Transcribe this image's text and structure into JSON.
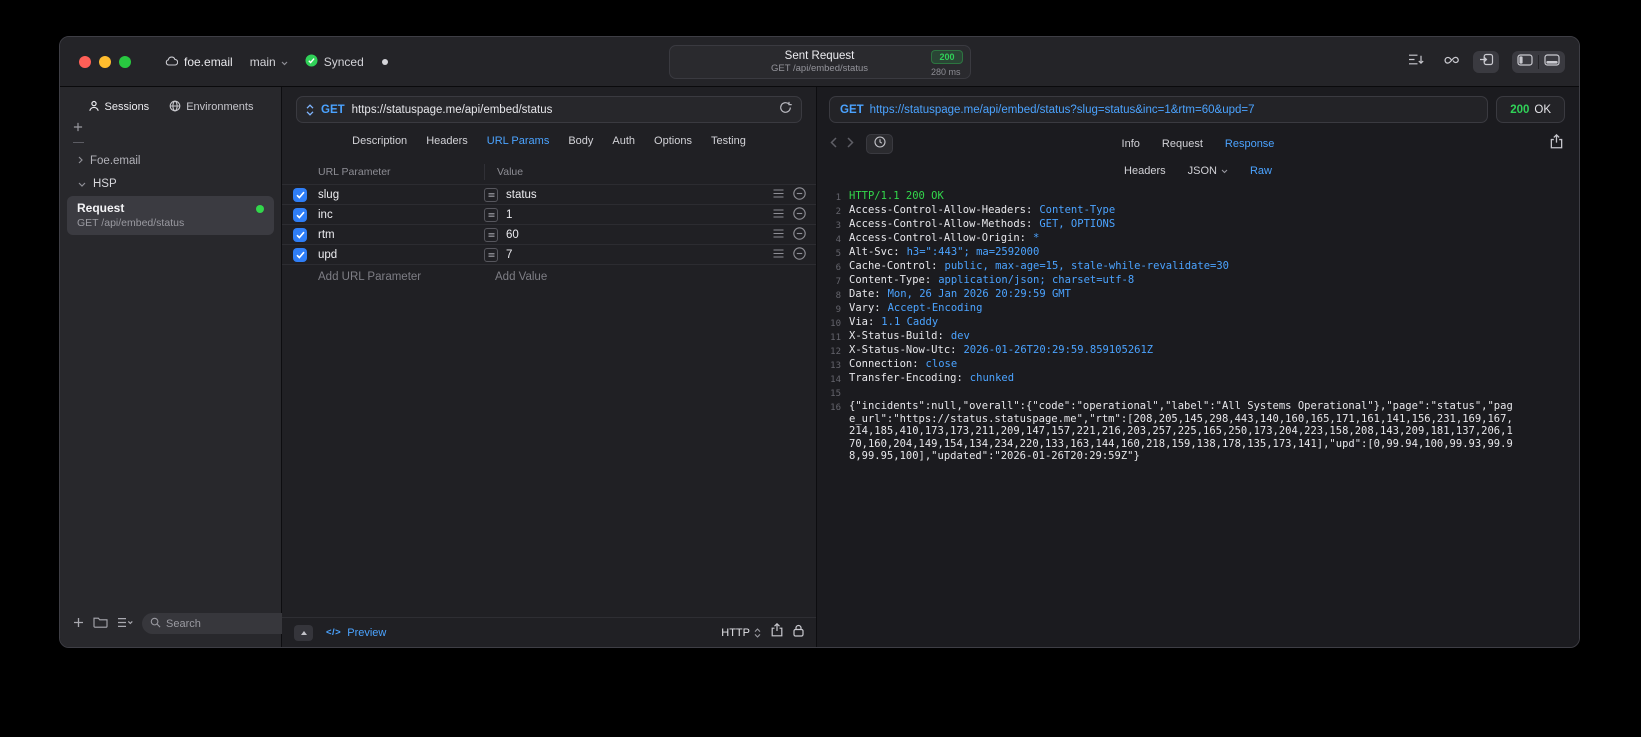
{
  "colors": {
    "accent_blue": "#4BA3FF",
    "success_green": "#30D158",
    "traffic_red": "#FF5F57",
    "traffic_yellow": "#FEBC2E",
    "traffic_green": "#28C840"
  },
  "icons": {
    "project": "cloud",
    "branch": "chevron-down",
    "synced": "check-circle",
    "sessions_tab": "person",
    "environments_tab": "globe",
    "method_selector": "up-down-arrows",
    "reload": "circular-arrow",
    "row_reorder": "hamburger-lines",
    "row_remove": "minus-circle",
    "share": "square-arrow-up",
    "lock": "padlock",
    "history": "clock",
    "search": "magnifier"
  },
  "titlebar": {
    "project": "foe.email",
    "branch": "main",
    "sync_status": "Synced",
    "request_title": "Sent Request",
    "status_badge": "200",
    "request_subtitle": "GET /api/embed/status",
    "duration": "280 ms"
  },
  "sidebar": {
    "tabs": [
      {
        "label": "Sessions"
      },
      {
        "label": "Environments"
      }
    ],
    "tree": {
      "group1": "Foe.email",
      "group2": "HSP"
    },
    "request_item": {
      "title": "Request",
      "subtitle": "GET /api/embed/status"
    },
    "search": {
      "placeholder": "Search"
    }
  },
  "request_editor": {
    "method": "GET",
    "url": "https://statuspage.me/api/embed/status",
    "tabs": [
      "Description",
      "Headers",
      "URL Params",
      "Body",
      "Auth",
      "Options",
      "Testing"
    ],
    "active_tab": "URL Params",
    "params": {
      "columns": {
        "name": "URL Parameter",
        "value": "Value"
      },
      "rows": [
        {
          "name": "slug",
          "value": "status",
          "checked": true
        },
        {
          "name": "inc",
          "value": "1",
          "checked": true
        },
        {
          "name": "rtm",
          "value": "60",
          "checked": true
        },
        {
          "name": "upd",
          "value": "7",
          "checked": true
        }
      ],
      "add_name": "Add URL Parameter",
      "add_value": "Add Value"
    },
    "footer": {
      "code_glyph": "</>",
      "preview": "Preview",
      "protocol": "HTTP"
    }
  },
  "response_viewer": {
    "method": "GET",
    "url": "https://statuspage.me/api/embed/status?slug=status&inc=1&rtm=60&upd=7",
    "status_code": "200",
    "status_text": "OK",
    "tabs": [
      "Info",
      "Request",
      "Response"
    ],
    "active_tab": "Response",
    "subtabs": [
      "Headers",
      "JSON",
      "Raw"
    ],
    "active_subtab": "Raw",
    "raw": {
      "status_line": {
        "num": "1",
        "text": "HTTP/1.1 200 OK"
      },
      "headers": [
        {
          "num": "2",
          "key": "Access-Control-Allow-Headers:",
          "value": "Content-Type"
        },
        {
          "num": "3",
          "key": "Access-Control-Allow-Methods:",
          "value": "GET, OPTIONS"
        },
        {
          "num": "4",
          "key": "Access-Control-Allow-Origin:",
          "value": "*"
        },
        {
          "num": "5",
          "key": "Alt-Svc:",
          "value": "h3=\":443\"; ma=2592000"
        },
        {
          "num": "6",
          "key": "Cache-Control:",
          "value": "public, max-age=15, stale-while-revalidate=30"
        },
        {
          "num": "7",
          "key": "Content-Type:",
          "value": "application/json; charset=utf-8"
        },
        {
          "num": "8",
          "key": "Date:",
          "value": "Mon, 26 Jan 2026 20:29:59 GMT"
        },
        {
          "num": "9",
          "key": "Vary:",
          "value": "Accept-Encoding"
        },
        {
          "num": "10",
          "key": "Via:",
          "value": "1.1 Caddy"
        },
        {
          "num": "11",
          "key": "X-Status-Build:",
          "value": "dev"
        },
        {
          "num": "12",
          "key": "X-Status-Now-Utc:",
          "value": "2026-01-26T20:29:59.859105261Z"
        },
        {
          "num": "13",
          "key": "Connection:",
          "value": "close"
        },
        {
          "num": "14",
          "key": "Transfer-Encoding:",
          "value": "chunked"
        }
      ],
      "blank": {
        "num": "15"
      },
      "body": {
        "num": "16",
        "text": "{\"incidents\":null,\"overall\":{\"code\":\"operational\",\"label\":\"All Systems Operational\"},\"page\":\"status\",\"page_url\":\"https://status.statuspage.me\",\"rtm\":[208,205,145,298,443,140,160,165,171,161,141,156,231,169,167,214,185,410,173,173,211,209,147,157,221,216,203,257,225,165,250,173,204,223,158,208,143,209,181,137,206,170,160,204,149,154,134,234,220,133,163,144,160,218,159,138,178,135,173,141],\"upd\":[0,99.94,100,99.93,99.98,99.95,100],\"updated\":\"2026-01-26T20:29:59Z\"}"
      }
    }
  }
}
